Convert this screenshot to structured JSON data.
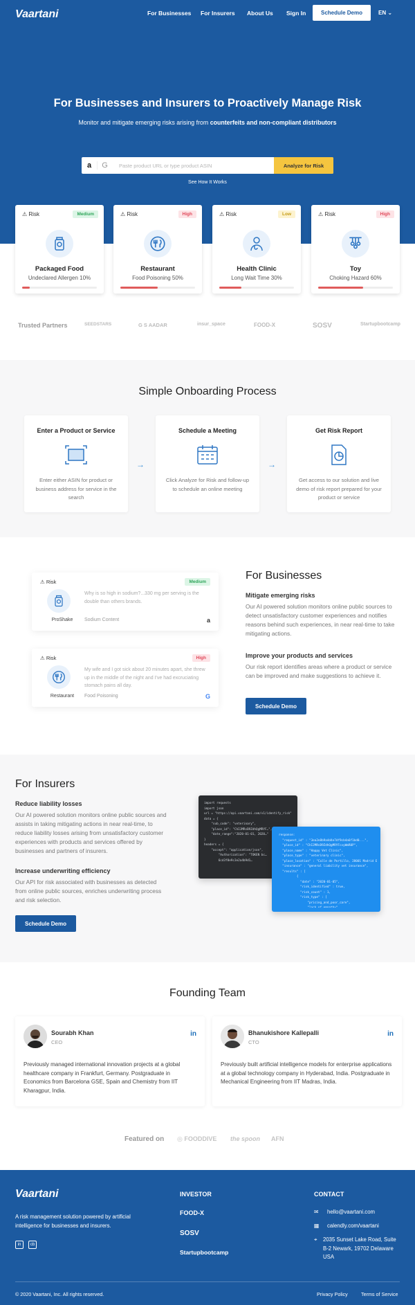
{
  "brand": {
    "logo": "Vaartani"
  },
  "nav": {
    "items": [
      "For Businesses",
      "For Insurers",
      "About Us",
      "Sign In"
    ],
    "demo": "Schedule Demo",
    "lang": "EN"
  },
  "hero": {
    "title": "For Businesses and Insurers to Proactively Manage Risk",
    "subtitle_pre": "Monitor and mitigate emerging risks arising from ",
    "subtitle_bold": "counterfeits and non-compliant distributors",
    "search_placeholder": "Paste product URL or type product ASIN",
    "analyze_button": "Analyze for Risk",
    "see_how": "See How It Works"
  },
  "risk_cards": [
    {
      "label": "Risk",
      "level": "Medium",
      "name": "Packaged Food",
      "detail": "Undeclared Allergen 10%",
      "progress": 0.1,
      "icon": "packaged-food-icon"
    },
    {
      "label": "Risk",
      "level": "High",
      "name": "Restaurant",
      "detail": "Food Poisoning 50%",
      "progress": 0.5,
      "icon": "restaurant-icon"
    },
    {
      "label": "Risk",
      "level": "Low",
      "name": "Health Clinic",
      "detail": "Long Wait Time 30%",
      "progress": 0.3,
      "icon": "doctor-icon"
    },
    {
      "label": "Risk",
      "level": "High",
      "name": "Toy",
      "detail": "Choking Hazard 60%",
      "progress": 0.6,
      "icon": "toy-icon"
    }
  ],
  "partners": {
    "label": "Trusted Partners",
    "logos": [
      "SEEDSTARS",
      "G S AADAR",
      "insur_space",
      "FOOD-X",
      "SOSV",
      "Startupbootcamp"
    ]
  },
  "onboarding": {
    "title": "Simple Onboarding Process",
    "steps": [
      {
        "title": "Enter a Product or Service",
        "text": "Enter either ASIN for product or business address for service in the search",
        "icon": "scan-icon"
      },
      {
        "title": "Schedule a Meeting",
        "text": "Click Analyze for Risk and follow-up to schedule an online meeting",
        "icon": "calendar-icon"
      },
      {
        "title": "Get Risk Report",
        "text": "Get access to our solution and live demo of risk report prepared for your product or service",
        "icon": "report-icon"
      }
    ]
  },
  "businesses": {
    "title": "For Businesses",
    "h1": "Mitigate emerging risks",
    "p1": "Our AI powered solution monitors online public sources to detect unsatisfactory customer experiences and notifies reasons behind such experiences, in near real-time to take mitigating actions.",
    "h2": "Improve your products and services",
    "p2": "Our risk report identifies areas where a product or service can be improved and make suggestions to achieve it.",
    "button": "Schedule Demo",
    "cards": [
      {
        "label": "Risk",
        "level": "Medium",
        "quote": "Why is so high in sodium?...330 mg per serving is the double than others brands.",
        "name": "ProShake",
        "category": "Sodium Content",
        "source": "a"
      },
      {
        "label": "Risk",
        "level": "High",
        "quote": "My wife and I got sick about 20 minutes apart, she threw up in the middle of the night and I've had excruciating stomach pains all day.",
        "name": "Restaurant",
        "category": "Food Poisoning",
        "source": "G"
      }
    ]
  },
  "insurers": {
    "title": "For Insurers",
    "h1": "Reduce liability losses",
    "p1": "Our AI powered solution monitors online public sources and assists in taking mitigating actions in near real-time, to reduce liability losses arising from unsatisfactory customer experiences with products and services offered by businesses and partners of insurers.",
    "h2": "Increase underwriting efficiency",
    "p2": "Our API for risk associated with businesses as detected from online public sources, enriches underwriting process and risk selection.",
    "button": "Schedule Demo",
    "code_dark": "import requests\nimport json\nurl = \"https://api.vaartani.com/v1/identify_risk\"\ndata = {\n    \"sub_code\": \"veterinary\",\n    \"place_id\": \"ChIJMRsB9ZdhQgMRYF…\",\n    \"date_range\":\"2020-01-01, 2020…\"\n}\nheaders = {\n    \"accept\": \"application/json\",\n        \"Authorization\": \"TOKEN bc…\n        6cd3f8e9c3e2a4b9d1…",
    "code_blue": "response:\n  \"request_id\" : \"3ea2e8b9a4d4e7df9cb4a6f1bd0...\",\n  \"place_id\" : \"ChIJMRsB9ZdhQgMRYFcvyWmR0P\",\n  \"place_name\" : \"Happy Vet Clinic\",\n  \"place_type\" : \"veterinary clinic\",\n  \"place_location\" : \"Calle de Portillo, 28001 Madrid ES\",\n  \"insurance\" : \"general liability vet insurance\",\n  \"results\" : [\n          {\n            \"date\" : \"2020-01-05\",\n            \"risk_identified\" : true,\n            \"risk_count\" : 1,\n            \"risk_type\" : [\n                \"pricing_and_poor_care\",\n                \"lack_of_empathy\""
  },
  "team": {
    "title": "Founding Team",
    "members": [
      {
        "name": "Sourabh Khan",
        "role": "CEO",
        "bio": "Previously managed international innovation projects at a global healthcare company in Frankfurt, Germany. Postgraduate in Economics from Barcelona GSE, Spain and Chemistry from IIT Kharagpur, India."
      },
      {
        "name": "Bhanukishore Kallepalli",
        "role": "CTO",
        "bio": "Previously built artificial intelligence models for enterprise applications at a global technology company in Hyderabad, India. Postgraduate in Mechanical Engineering from IIT Madras, India."
      }
    ]
  },
  "featured": {
    "label": "Featured on",
    "logos": [
      "FOODDIVE",
      "the spoon",
      "AFN"
    ]
  },
  "footer": {
    "logo": "Vaartani",
    "tagline": "A risk management solution powered by artificial intelligence for businesses and insurers.",
    "investor_title": "INVESTOR",
    "investors": [
      "FOOD-X",
      "SOSV",
      "Startupbootcamp"
    ],
    "contact_title": "CONTACT",
    "email": "hello@vaartani.com",
    "calendly": "calendly.com/vaartani",
    "address": "2035 Sunset Lake Road, Suite B-2 Newark, 19702 Delaware USA",
    "copyright": "© 2020 Vaartani, Inc. All rights reserved.",
    "privacy": "Privacy Policy",
    "terms": "Terms of Service"
  },
  "colors": {
    "primary": "#1c5aa0",
    "accent": "#f5c53f",
    "danger": "#e05b5b"
  }
}
